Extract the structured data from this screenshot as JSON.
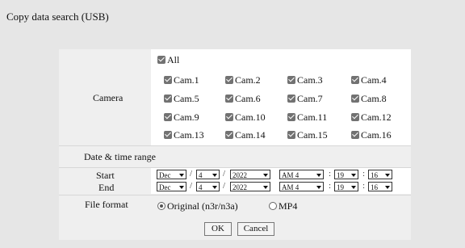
{
  "title": "Copy data search (USB)",
  "camera": {
    "label": "Camera",
    "all": "All",
    "cams": [
      "Cam.1",
      "Cam.2",
      "Cam.3",
      "Cam.4",
      "Cam.5",
      "Cam.6",
      "Cam.7",
      "Cam.8",
      "Cam.9",
      "Cam.10",
      "Cam.11",
      "Cam.12",
      "Cam.13",
      "Cam.14",
      "Cam.15",
      "Cam.16"
    ]
  },
  "range": {
    "label": "Date & time range"
  },
  "start": {
    "label": "Start",
    "month": "Dec",
    "day": "4",
    "year": "2022",
    "hour": "AM 4",
    "minute": "19",
    "second": "16"
  },
  "end": {
    "label": "End",
    "month": "Dec",
    "day": "4",
    "year": "2022",
    "hour": "AM 4",
    "minute": "19",
    "second": "16"
  },
  "separators": {
    "slash": "/",
    "colon": ":"
  },
  "file_format": {
    "label": "File format",
    "original": "Original (n3r/n3a)",
    "mp4": "MP4"
  },
  "buttons": {
    "ok": "OK",
    "cancel": "Cancel"
  }
}
